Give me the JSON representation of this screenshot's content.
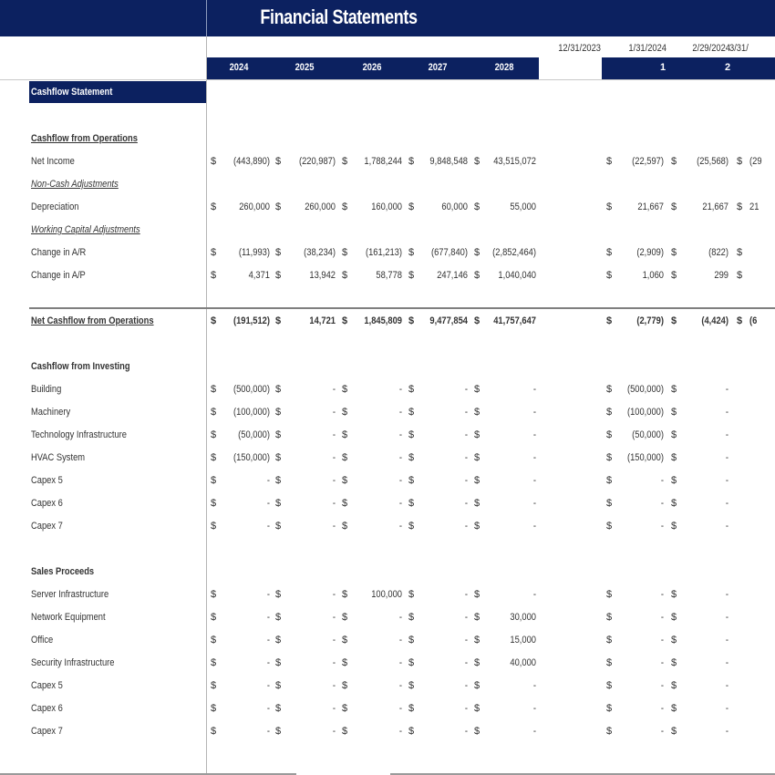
{
  "title": "Financial Statements",
  "colors": {
    "header_navy": "#0c2160",
    "text": "#333333"
  },
  "dates": [
    "12/31/2023",
    "1/31/2024",
    "2/29/2024",
    "3/31/"
  ],
  "years": [
    "2024",
    "2025",
    "2026",
    "2027",
    "2028"
  ],
  "periods": [
    "1",
    "2"
  ],
  "section_title": "Cashflow Statement",
  "operations": {
    "heading": "Cashflow from Operations",
    "rows": [
      {
        "label": "Net Income",
        "annual": [
          "(443,890)",
          "(220,987)",
          "1,788,244",
          "9,848,548",
          "43,515,072"
        ],
        "monthly": [
          "(22,597)",
          "(25,568)",
          "(29"
        ]
      },
      {
        "label": "Non-Cash Adjustments",
        "subheading": true
      },
      {
        "label": "Depreciation",
        "annual": [
          "260,000",
          "260,000",
          "160,000",
          "60,000",
          "55,000"
        ],
        "monthly": [
          "21,667",
          "21,667",
          "21"
        ]
      },
      {
        "label": "Working Capital Adjustments",
        "subheading": true
      },
      {
        "label": "Change in A/R",
        "annual": [
          "(11,993)",
          "(38,234)",
          "(161,213)",
          "(677,840)",
          "(2,852,464)"
        ],
        "monthly": [
          "(2,909)",
          "(822)",
          ""
        ]
      },
      {
        "label": "Change in A/P",
        "annual": [
          "4,371",
          "13,942",
          "58,778",
          "247,146",
          "1,040,040"
        ],
        "monthly": [
          "1,060",
          "299",
          ""
        ]
      }
    ],
    "total": {
      "label": "Net Cashflow from Operations",
      "annual": [
        "(191,512)",
        "14,721",
        "1,845,809",
        "9,477,854",
        "41,757,647"
      ],
      "monthly": [
        "(2,779)",
        "(4,424)",
        "(6"
      ]
    }
  },
  "investing": {
    "heading": "Cashflow from Investing",
    "rows": [
      {
        "label": "Building",
        "annual": [
          "(500,000)",
          "-",
          "-",
          "-",
          "-"
        ],
        "monthly": [
          "(500,000)",
          "-"
        ]
      },
      {
        "label": "Machinery",
        "annual": [
          "(100,000)",
          "-",
          "-",
          "-",
          "-"
        ],
        "monthly": [
          "(100,000)",
          "-"
        ]
      },
      {
        "label": "Technology Infrastructure",
        "annual": [
          "(50,000)",
          "-",
          "-",
          "-",
          "-"
        ],
        "monthly": [
          "(50,000)",
          "-"
        ]
      },
      {
        "label": "HVAC System",
        "annual": [
          "(150,000)",
          "-",
          "-",
          "-",
          "-"
        ],
        "monthly": [
          "(150,000)",
          "-"
        ]
      },
      {
        "label": "Capex 5",
        "annual": [
          "-",
          "-",
          "-",
          "-",
          "-"
        ],
        "monthly": [
          "-",
          "-"
        ]
      },
      {
        "label": "Capex 6",
        "annual": [
          "-",
          "-",
          "-",
          "-",
          "-"
        ],
        "monthly": [
          "-",
          "-"
        ]
      },
      {
        "label": "Capex 7",
        "annual": [
          "-",
          "-",
          "-",
          "-",
          "-"
        ],
        "monthly": [
          "-",
          "-"
        ]
      }
    ]
  },
  "sales": {
    "heading": "Sales Proceeds",
    "rows": [
      {
        "label": "Server Infrastructure",
        "annual": [
          "-",
          "-",
          "100,000",
          "-",
          "-"
        ],
        "monthly": [
          "-",
          "-"
        ]
      },
      {
        "label": "Network Equipment",
        "annual": [
          "-",
          "-",
          "-",
          "-",
          "30,000"
        ],
        "monthly": [
          "-",
          "-"
        ]
      },
      {
        "label": "Office",
        "annual": [
          "-",
          "-",
          "-",
          "-",
          "15,000"
        ],
        "monthly": [
          "-",
          "-"
        ]
      },
      {
        "label": "Security Infrastructure",
        "annual": [
          "-",
          "-",
          "-",
          "-",
          "40,000"
        ],
        "monthly": [
          "-",
          "-"
        ]
      },
      {
        "label": "Capex 5",
        "annual": [
          "-",
          "-",
          "-",
          "-",
          "-"
        ],
        "monthly": [
          "-",
          "-"
        ]
      },
      {
        "label": "Capex 6",
        "annual": [
          "-",
          "-",
          "-",
          "-",
          "-"
        ],
        "monthly": [
          "-",
          "-"
        ]
      },
      {
        "label": "Capex 7",
        "annual": [
          "-",
          "-",
          "-",
          "-",
          "-"
        ],
        "monthly": [
          "-",
          "-"
        ]
      }
    ]
  },
  "currency_symbol": "$"
}
